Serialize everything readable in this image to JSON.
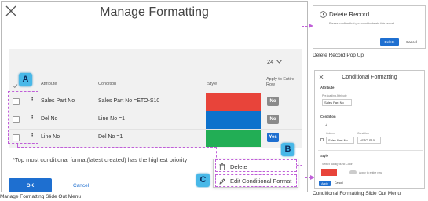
{
  "main": {
    "title": "Manage Formatting",
    "rows_per_page": "24",
    "headers": {
      "attribute": "Attribute",
      "condition": "Condition",
      "style": "Style",
      "apply": "Apply to Entire Row"
    },
    "rows": [
      {
        "attribute": "Sales Part No",
        "condition": "Sales Part No =ETO-S10",
        "color": "#e8443a",
        "apply": "No"
      },
      {
        "attribute": "Del No",
        "condition": "Line No =1",
        "color": "#0d72cc",
        "apply": "No"
      },
      {
        "attribute": "Line No",
        "condition": "Del No =1",
        "color": "#22ae55",
        "apply": "Yes"
      }
    ],
    "footnote": "*Top most conditional format(latest created) has the highest priority",
    "ok_label": "OK",
    "cancel_label": "Cancel"
  },
  "slide_menu": {
    "delete_label": "Delete",
    "edit_label": "Edit Conditional Format"
  },
  "callouts": {
    "a": "A",
    "b": "B",
    "c": "C"
  },
  "delete_popup": {
    "title": "Delete Record",
    "message": "Please confirm that you want to delete this record.",
    "delete_label": "Delete",
    "cancel_label": "Cancel"
  },
  "cf_panel": {
    "title": "Conditional Formatting",
    "attribute_section": "Attribute",
    "attribute_label": "Pre-loading Attribute",
    "attribute_value": "Sales Part No",
    "condition_section": "Condition",
    "column_label": "Column",
    "condition_label": "Condition",
    "column_value": "Sales Part No",
    "condition_value": "=ETO-S10",
    "style_section": "Style",
    "bg_label": "Select Background Color",
    "apply_row_label": "Apply to entire row",
    "apply_label": "Apply",
    "cancel_label": "Cancel"
  },
  "captions": {
    "delete_popup": "Delete Record Pop Up",
    "main": "Manage Formatting Slide Out Menu",
    "cf_panel": "Conditional Formatting Slide Out Menu"
  },
  "colors": {
    "primary": "#1e6fd0",
    "callout": "#48b8e8",
    "connector": "#c05fd8",
    "badge": "#8a8a8a"
  }
}
